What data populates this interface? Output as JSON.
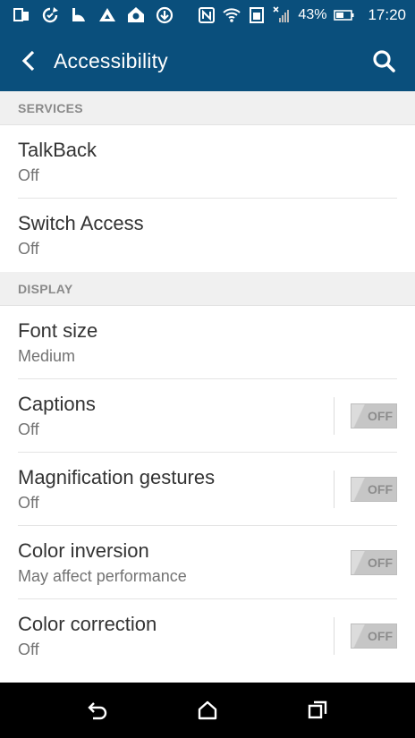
{
  "status_bar": {
    "left_icons": [
      "copy-icon",
      "sync-icon",
      "weather-icon",
      "drive-icon",
      "home-icon",
      "download-icon"
    ],
    "right_icons": [
      "nfc-icon",
      "wifi-icon",
      "sim-icon",
      "signal-icon"
    ],
    "battery_percent": "43%",
    "time": "17:20"
  },
  "app_bar": {
    "title": "Accessibility",
    "back_icon": "back-arrow-icon",
    "search_icon": "search-icon"
  },
  "sections": {
    "services": {
      "header": "SERVICES",
      "items": [
        {
          "title": "TalkBack",
          "subtitle": "Off"
        },
        {
          "title": "Switch Access",
          "subtitle": "Off"
        }
      ]
    },
    "display": {
      "header": "DISPLAY",
      "items": [
        {
          "title": "Font size",
          "subtitle": "Medium"
        },
        {
          "title": "Captions",
          "subtitle": "Off",
          "toggle": "OFF"
        },
        {
          "title": "Magnification gestures",
          "subtitle": "Off",
          "toggle": "OFF"
        },
        {
          "title": "Color inversion",
          "subtitle": "May affect performance",
          "toggle": "OFF"
        },
        {
          "title": "Color correction",
          "subtitle": "Off",
          "toggle": "OFF"
        }
      ]
    }
  },
  "nav_bar": {
    "icons": [
      "nav-back-icon",
      "nav-home-icon",
      "nav-recents-icon"
    ]
  },
  "colors": {
    "primary": "#0a4f7c",
    "section_bg": "#f0f0f0",
    "title_text": "#333333",
    "sub_text": "#737373"
  }
}
